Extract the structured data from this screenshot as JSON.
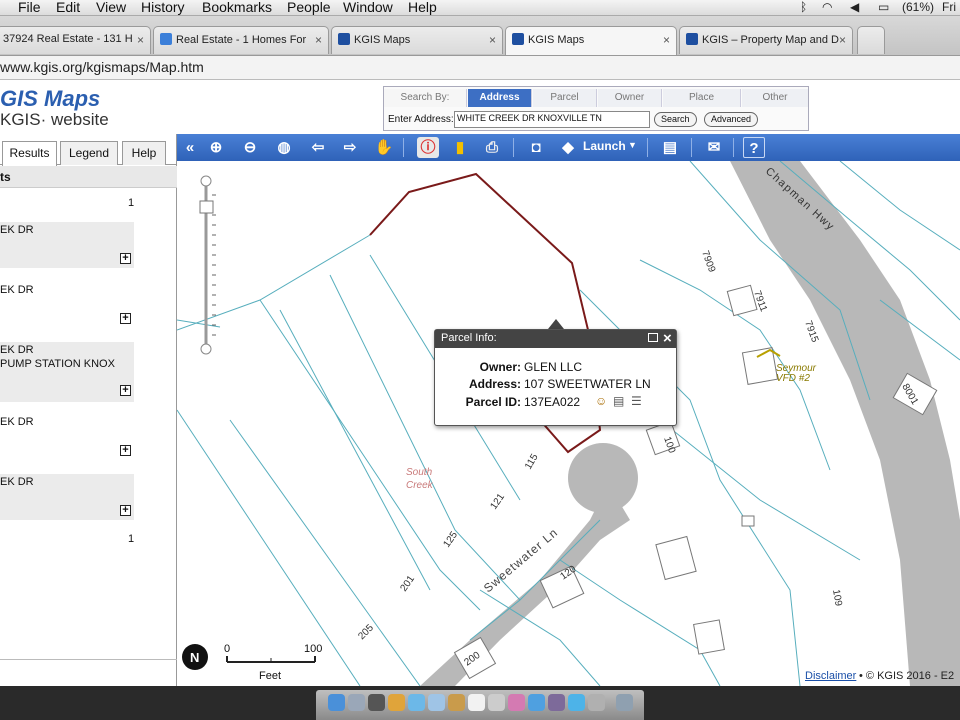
{
  "menubar": {
    "items": [
      "File",
      "Edit",
      "View",
      "History",
      "Bookmarks",
      "People",
      "Window",
      "Help"
    ],
    "battery": "(61%)",
    "day": "Fri"
  },
  "tabs": [
    {
      "label": "37924 Real Estate - 131 H"
    },
    {
      "label": "Real Estate - 1 Homes For"
    },
    {
      "label": "KGIS Maps"
    },
    {
      "label": "KGIS Maps"
    },
    {
      "label": "KGIS – Property Map and D"
    }
  ],
  "address_bar": {
    "url": "www.kgis.org/kgismaps/Map.htm"
  },
  "header": {
    "logo_title": "GIS Maps",
    "logo_sub": "KGIS· website",
    "search_by_label": "Search By:",
    "search_tabs": [
      "Address",
      "Parcel",
      "Owner",
      "Place",
      "Other"
    ],
    "enter_address_label": "Enter Address:",
    "address_value": "WHITE CREEK DR KNOXVILLE TN",
    "search_button": "Search",
    "advanced_button": "Advanced"
  },
  "left_panel": {
    "tabs": [
      "Results",
      "Legend",
      "Help"
    ],
    "results_header": "ts",
    "top_count": "1",
    "results": [
      {
        "line1": "EK DR",
        "line2": ""
      },
      {
        "line1": "EK DR",
        "line2": ""
      },
      {
        "line1": "EK DR",
        "line2": "PUMP STATION KNOX"
      },
      {
        "line1": "EK DR",
        "line2": ""
      },
      {
        "line1": "EK DR",
        "line2": ""
      }
    ],
    "bottom_count": "1"
  },
  "toolbar": {
    "launch_label": "Launch"
  },
  "map": {
    "street_labels": [
      "Chapman Hwy",
      "Sweetwater Ln"
    ],
    "creek_label": [
      "South",
      "Creek"
    ],
    "fire_station_label": [
      "Seymour",
      "VFD #2"
    ],
    "parcel_numbers": [
      "7909",
      "7911",
      "7915",
      "8001",
      "100",
      "115",
      "121",
      "125",
      "201",
      "205",
      "120",
      "200",
      "109"
    ],
    "scale": {
      "zero": "0",
      "max": "100",
      "unit": "Feet"
    }
  },
  "popup": {
    "title": "Parcel Info:",
    "owner_label": "Owner:",
    "owner_value": "GLEN LLC",
    "address_label": "Address:",
    "address_value": "107 SWEETWATER LN",
    "parcel_label": "Parcel ID:",
    "parcel_value": "137EA022"
  },
  "footer": {
    "disclaimer": "Disclaimer",
    "copyright": "• © KGIS 2016 - E2"
  },
  "colors": {
    "toolbar_blue": "#3a6fc8",
    "parcel_outline": "#7a1a1a",
    "road_gray": "#b8b8b8",
    "parcel_line": "#57aebd"
  }
}
